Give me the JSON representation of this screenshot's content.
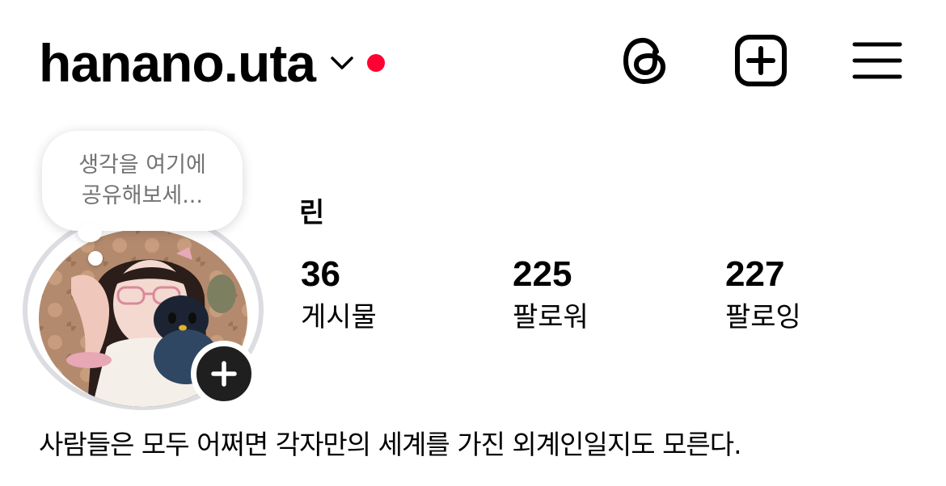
{
  "header": {
    "username": "hanano.uta",
    "icons": [
      "chevron-down-icon",
      "threads-icon",
      "create-icon",
      "menu-icon"
    ],
    "notification_dot_color": "#ff0033"
  },
  "note": {
    "line1": "생각을 여기에",
    "line2": "공유해보세..."
  },
  "profile": {
    "display_name": "린",
    "bio": "사람들은 모두 어쩌면 각자만의 세계를 가진 외계인일지도 모른다."
  },
  "stats": {
    "posts": {
      "count": "36",
      "label": "게시물"
    },
    "followers": {
      "count": "225",
      "label": "팔로워"
    },
    "following": {
      "count": "227",
      "label": "팔로잉"
    }
  },
  "colors": {
    "ring": "#dcdde2",
    "add_button": "#1f1f1f",
    "note_text": "#737373"
  }
}
